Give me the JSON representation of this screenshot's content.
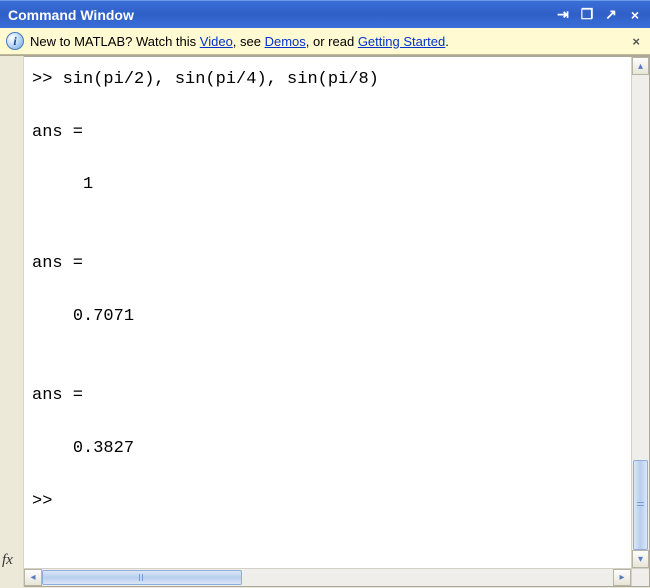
{
  "titlebar": {
    "title": "Command Window"
  },
  "infobar": {
    "prefix": "New to MATLAB? Watch this ",
    "link1": "Video",
    "mid1": ", see ",
    "link2": "Demos",
    "mid2": ", or read ",
    "link3": "Getting Started",
    "suffix": "."
  },
  "editor": {
    "prompt": ">>",
    "input1": "sin(pi/2), sin(pi/4), sin(pi/8)",
    "ans_label": "ans =",
    "results": [
      "1",
      "0.7071",
      "0.3827"
    ]
  },
  "gutter": {
    "fx": "fx"
  },
  "icons": {
    "info": "i",
    "dock": "⇥",
    "restore": "❐",
    "undock": "↗",
    "close": "×",
    "up": "▴",
    "down": "▾",
    "left": "◂",
    "right": "▸"
  }
}
